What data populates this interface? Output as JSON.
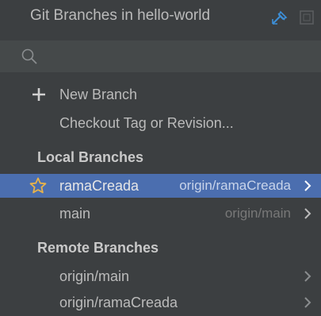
{
  "header": {
    "title": "Git Branches in hello-world"
  },
  "search": {
    "value": "",
    "placeholder": ""
  },
  "actions": [
    {
      "label": "New Branch",
      "icon": "plus-icon"
    },
    {
      "label": "Checkout Tag or Revision..."
    }
  ],
  "local_branches": {
    "header": "Local Branches",
    "items": [
      {
        "name": "ramaCreada",
        "tracking": "origin/ramaCreada",
        "favorite": true,
        "selected": true
      },
      {
        "name": "main",
        "tracking": "origin/main",
        "favorite": false,
        "selected": false
      }
    ]
  },
  "remote_branches": {
    "header": "Remote Branches",
    "items": [
      {
        "name": "origin/main"
      },
      {
        "name": "origin/ramaCreada"
      }
    ]
  },
  "colors": {
    "background": "#3c3f41",
    "search_background": "#45494a",
    "selection": "#4b6eaf",
    "accent_icon": "#3d8fd8",
    "star": "#e8b34a"
  }
}
